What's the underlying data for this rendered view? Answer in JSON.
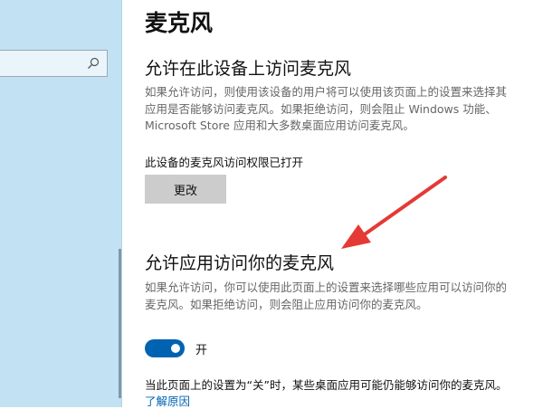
{
  "page": {
    "title": "麦克风"
  },
  "section1": {
    "title": "允许在此设备上访问麦克风",
    "desc_line1": "如果允许访问，则使用该设备的用户将可以使用该页面上的设置来选择其",
    "desc_line2": "应用是否能够访问麦克风。如果拒绝访问，则会阻止 Windows 功能、",
    "desc_line3": "Microsoft Store 应用和大多数桌面应用访问麦克风。",
    "status": "此设备的麦克风访问权限已打开",
    "change_button": "更改"
  },
  "section2": {
    "title": "允许应用访问你的麦克风",
    "desc_line1": "如果允许访问，你可以使用此页面上的设置来选择哪些应用可以访问你的",
    "desc_line2": "麦克风。如果拒绝访问，则会阻止应用访问你的麦克风。",
    "toggle_state": "开",
    "toggle_on": true,
    "note": "当此页面上的设置为“关”时，某些桌面应用可能仍能够访问你的麦克风。",
    "learn_more_link": "了解原因"
  },
  "sidebar": {
    "search_icon": "search-icon"
  },
  "colors": {
    "accent": "#0063b1",
    "sidebar_bg": "#c2e2f3",
    "arrow": "#e53935"
  }
}
